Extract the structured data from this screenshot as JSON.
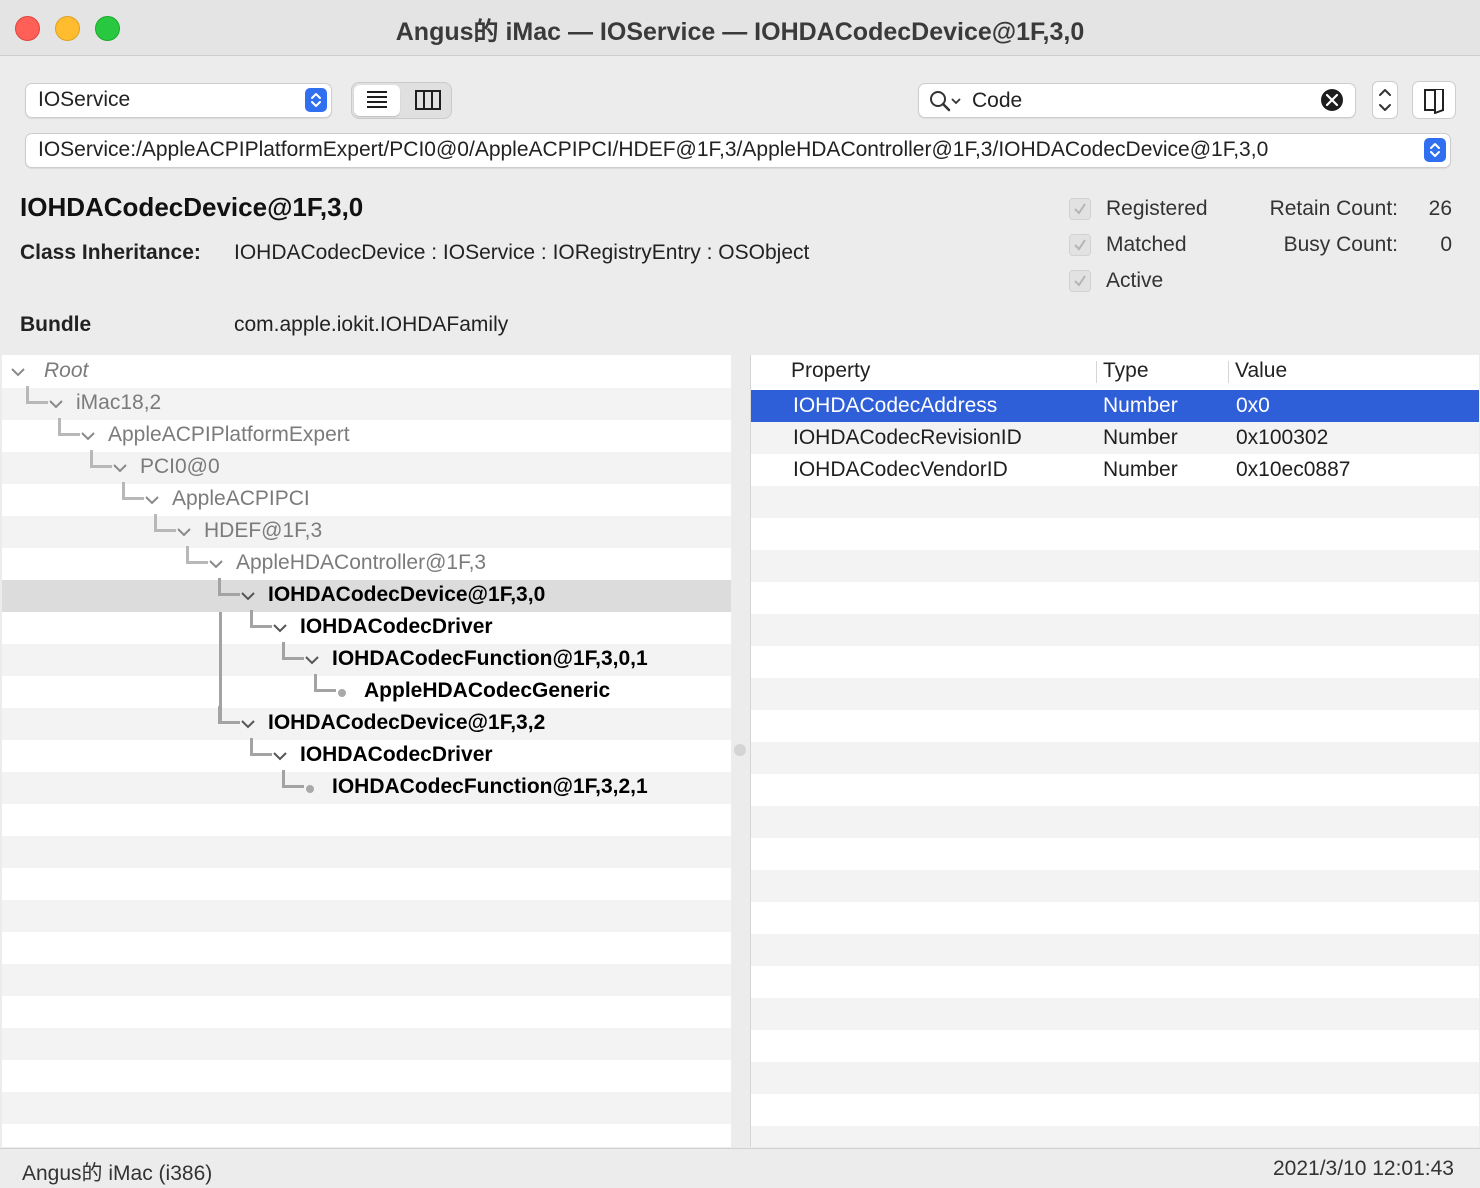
{
  "window": {
    "title": "Angus的 iMac — IOService — IOHDACodecDevice@1F,3,0"
  },
  "toolbar": {
    "plane_select": "IOService",
    "search_value": "Code",
    "path": "IOService:/AppleACPIPlatformExpert/PCI0@0/AppleACPIPCI/HDEF@1F,3/AppleHDAController@1F,3/IOHDACodecDevice@1F,3,0"
  },
  "header": {
    "object_name": "IOHDACodecDevice@1F,3,0",
    "class_label": "Class Inheritance:",
    "class_value": "IOHDACodecDevice : IOService : IORegistryEntry : OSObject",
    "bundle_label": "Bundle",
    "bundle_value": "com.apple.iokit.IOHDAFamily",
    "flags": [
      "Registered",
      "Matched",
      "Active"
    ],
    "retain_label": "Retain Count:",
    "retain_value": "26",
    "busy_label": "Busy Count:",
    "busy_value": "0"
  },
  "tree": [
    {
      "label": "Root",
      "depth": 0
    },
    {
      "label": "iMac18,2",
      "depth": 1
    },
    {
      "label": "AppleACPIPlatformExpert",
      "depth": 2
    },
    {
      "label": "PCI0@0",
      "depth": 3
    },
    {
      "label": "AppleACPIPCI",
      "depth": 4
    },
    {
      "label": "HDEF@1F,3",
      "depth": 5
    },
    {
      "label": "AppleHDAController@1F,3",
      "depth": 6
    },
    {
      "label": "IOHDACodecDevice@1F,3,0",
      "depth": 7,
      "selected": true
    },
    {
      "label": "IOHDACodecDriver",
      "depth": 8
    },
    {
      "label": "IOHDACodecFunction@1F,3,0,1",
      "depth": 9
    },
    {
      "label": "AppleHDACodecGeneric",
      "depth": 10,
      "leaf": true
    },
    {
      "label": "IOHDACodecDevice@1F,3,2",
      "depth": 7
    },
    {
      "label": "IOHDACodecDriver",
      "depth": 8
    },
    {
      "label": "IOHDACodecFunction@1F,3,2,1",
      "depth": 9,
      "leaf": true
    }
  ],
  "properties": {
    "columns": [
      "Property",
      "Type",
      "Value"
    ],
    "rows": [
      [
        "IOHDACodecAddress",
        "Number",
        "0x0"
      ],
      [
        "IOHDACodecRevisionID",
        "Number",
        "0x100302"
      ],
      [
        "IOHDACodecVendorID",
        "Number",
        "0x10ec0887"
      ]
    ]
  },
  "status": {
    "machine": "Angus的 iMac (i386)",
    "timestamp": "2021/3/10 12:01:43"
  },
  "colors": {
    "selection": "#2f5fd8",
    "accent": "#2f6ff0"
  }
}
